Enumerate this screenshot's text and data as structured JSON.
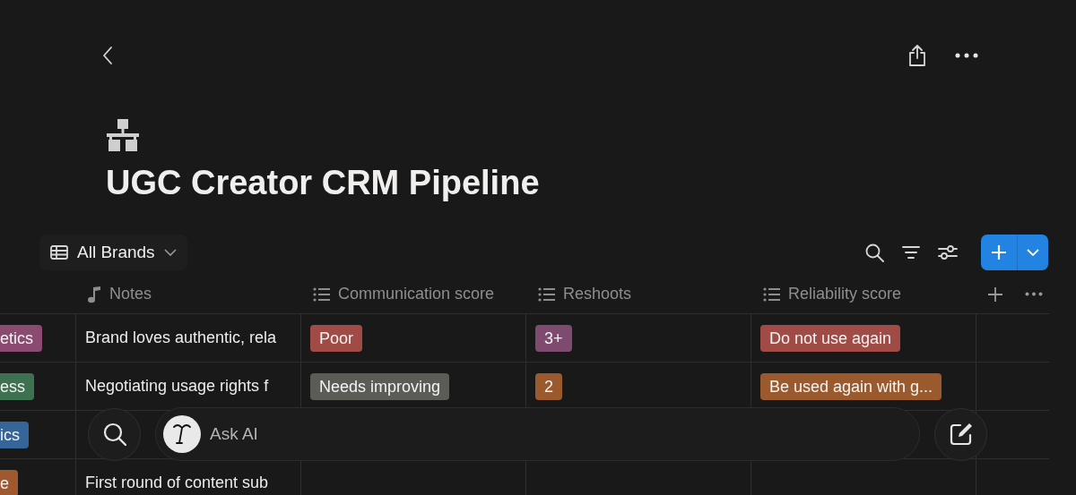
{
  "page": {
    "title": "UGC Creator CRM Pipeline"
  },
  "view": {
    "label": "All Brands"
  },
  "table": {
    "columns": [
      {
        "label": "Notes",
        "kind": "text"
      },
      {
        "label": "Communication score",
        "kind": "select"
      },
      {
        "label": "Reshoots",
        "kind": "select"
      },
      {
        "label": "Reliability score",
        "kind": "select"
      }
    ],
    "rows": [
      {
        "tag": {
          "label": "etics",
          "color": "#8b4a70"
        },
        "notes": "Brand loves authentic, rela",
        "communication": {
          "label": "Poor",
          "color": "#a04b45"
        },
        "reshoots": {
          "label": "3+",
          "color": "#7f4a70"
        },
        "reliability": {
          "label": "Do not use again",
          "color": "#a04b45"
        }
      },
      {
        "tag": {
          "label": "ess",
          "color": "#3e7150"
        },
        "notes": "Negotiating usage rights f",
        "communication": {
          "label": "Needs improving",
          "color": "#5c5c57"
        },
        "reshoots": {
          "label": "2",
          "color": "#9a5a2d"
        },
        "reliability": {
          "label": "Be used again with g...",
          "color": "#9a5a2d"
        }
      },
      {
        "tag": {
          "label": "ics",
          "color": "#36659a"
        }
      },
      {
        "tag": {
          "label": "e",
          "color": "#a0592f"
        },
        "notes": "First round of content sub"
      }
    ]
  },
  "dock": {
    "ask_label": "Ask AI"
  }
}
